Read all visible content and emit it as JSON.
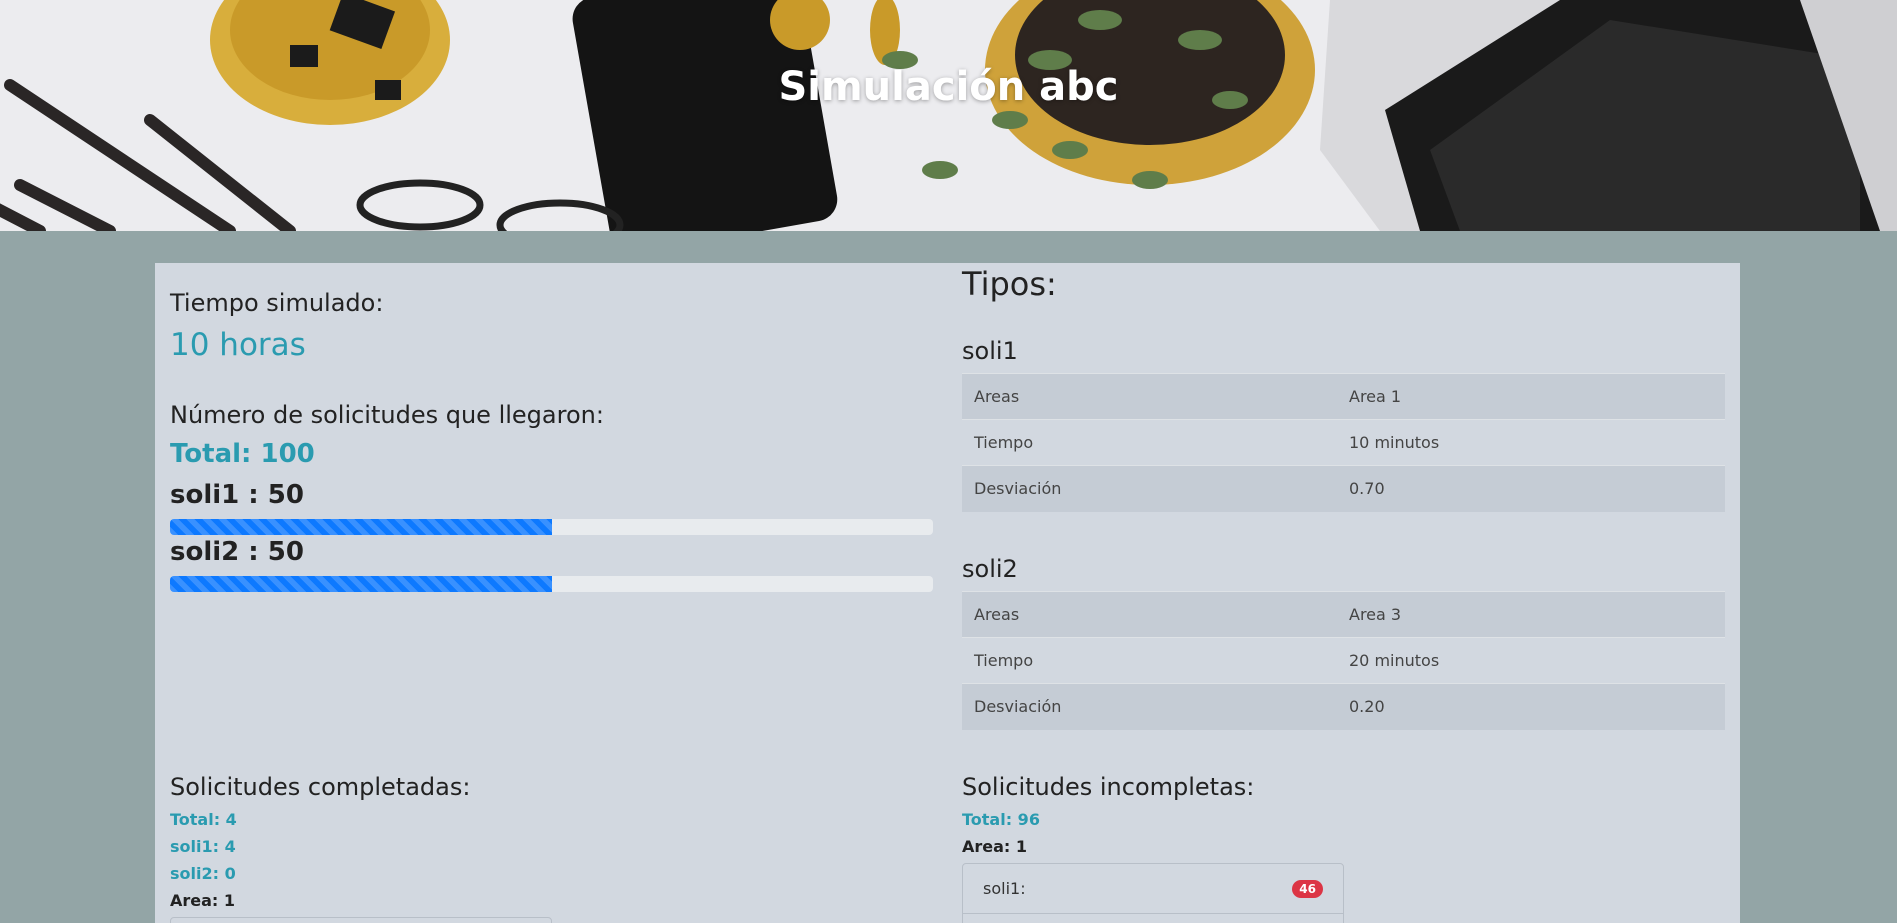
{
  "header": {
    "title": "Simulación abc"
  },
  "simulation": {
    "time_label": "Tiempo simulado:",
    "time_value": "10 horas",
    "requests_label": "Número de solicitudes que llegaron:",
    "requests_total": "Total: 100",
    "request_types": [
      {
        "label": "soli1 : 50",
        "progress": 0.5
      },
      {
        "label": "soli2 : 50",
        "progress": 0.5
      }
    ]
  },
  "tipos": {
    "title": "Tipos:",
    "types": [
      {
        "name": "soli1",
        "rows": [
          {
            "key": "Areas",
            "value": "Area 1"
          },
          {
            "key": "Tiempo",
            "value": "10 minutos"
          },
          {
            "key": "Desviación",
            "value": "0.70"
          }
        ]
      },
      {
        "name": "soli2",
        "rows": [
          {
            "key": "Areas",
            "value": "Area 3"
          },
          {
            "key": "Tiempo",
            "value": "20 minutos"
          },
          {
            "key": "Desviación",
            "value": "0.20"
          }
        ]
      }
    ]
  },
  "completed": {
    "title": "Solicitudes completadas:",
    "total": "Total: 4",
    "soli1": "soli1: 4",
    "soli2": "soli2: 0",
    "area": "Area: 1"
  },
  "incomplete": {
    "title": "Solicitudes incompletas:",
    "total": "Total: 96",
    "area": "Area: 1",
    "items": [
      {
        "label": "soli1:",
        "count": "46"
      }
    ]
  },
  "colors": {
    "accent": "#2a9bb0",
    "progress": "#0d79ff",
    "badge": "#dc3545",
    "page_bg": "#93a5a6",
    "panel_bg": "#d2d8e0"
  }
}
